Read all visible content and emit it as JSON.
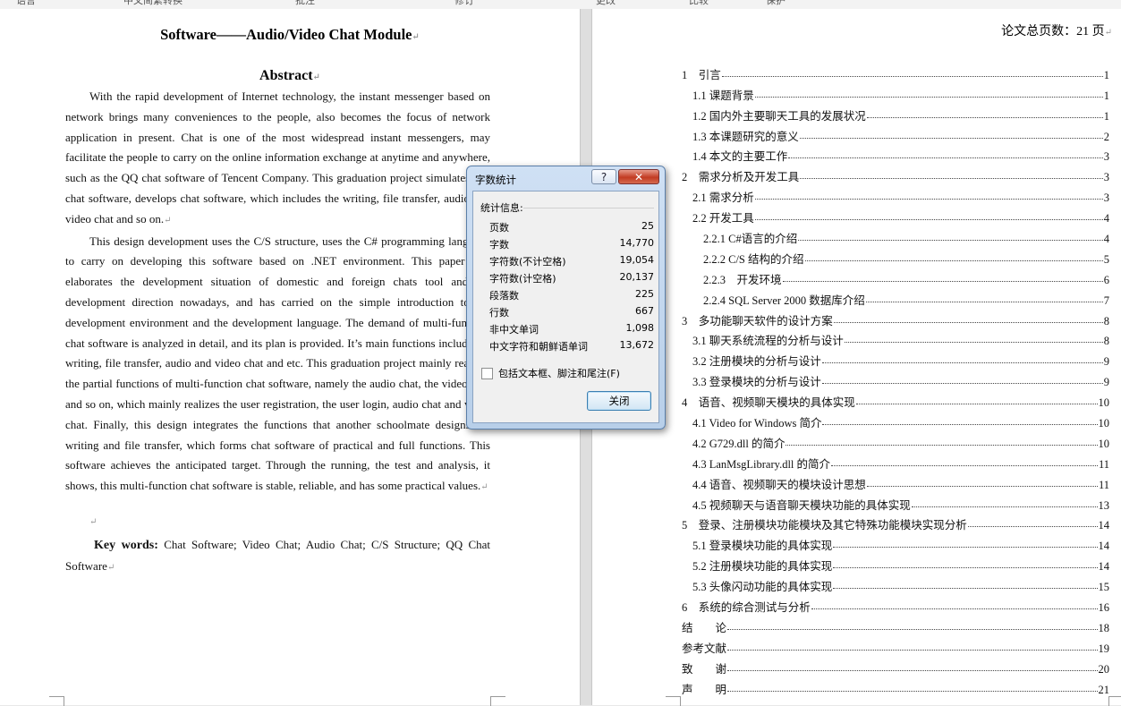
{
  "ribbon": {
    "tabs": [
      "语言",
      "中文简繁转换",
      "批注",
      "修订",
      "更改",
      "比较",
      "保护"
    ]
  },
  "left_page": {
    "title": "Software——Audio/Video Chat Module",
    "abstract_heading": "Abstract",
    "paragraph1": "With the rapid development of Internet technology, the instant messenger based on network brings many conveniences to the people, also becomes the focus of network application in present. Chat is one of the most widespread instant messengers, may facilitate the people to carry on the online information exchange at anytime and anywhere, such as the QQ chat software of Tencent Company. This graduation project simulates QQ chat software, develops chat software, which includes the writing, file transfer, audio and video chat and so on.",
    "paragraph2": "This design development uses the C/S structure, uses the C# programming language to carry on developing this software based on .NET environment. This paper first elaborates the development situation of domestic and foreign chats tool and the development direction nowadays, and has carried on the simple introduction to the development environment and the development language. The demand of multi-function chat software is analyzed in detail, and its plan is provided. It’s main functions include the writing, file transfer, audio and video chat and etc. This graduation project mainly realizes the partial functions of multi-function chat software, namely the audio chat, the video chat and so on, which mainly realizes the user registration, the user login, audio chat and video chat. Finally, this design integrates the functions that another schoolmate designs the writing and file transfer, which forms chat software of practical and full functions. This software achieves the anticipated target. Through the running, the test and analysis, it shows, this multi-function chat software is stable, reliable, and has some practical values.",
    "keywords_label": "Key words:",
    "keywords_value": "Chat Software; Video Chat; Audio Chat; C/S Structure; QQ Chat Software"
  },
  "right_page": {
    "page_count": "论文总页数：21 页",
    "toc": [
      {
        "label": "1　引言",
        "page": "1",
        "level": 0
      },
      {
        "label": "1.1 课题背景",
        "page": "1",
        "level": 1
      },
      {
        "label": "1.2 国内外主要聊天工具的发展状况",
        "page": "1",
        "level": 1
      },
      {
        "label": "1.3 本课题研究的意义",
        "page": "2",
        "level": 1
      },
      {
        "label": "1.4 本文的主要工作",
        "page": "3",
        "level": 1
      },
      {
        "label": "2　需求分析及开发工具",
        "page": "3",
        "level": 0
      },
      {
        "label": "2.1 需求分析",
        "page": "3",
        "level": 1
      },
      {
        "label": "2.2 开发工具",
        "page": "4",
        "level": 1
      },
      {
        "label": "2.2.1 C#语言的介绍",
        "page": "4",
        "level": 2
      },
      {
        "label": "2.2.2 C/S 结构的介绍",
        "page": "5",
        "level": 2
      },
      {
        "label": "2.2.3　开发环境",
        "page": "6",
        "level": 2
      },
      {
        "label": "2.2.4 SQL Server 2000 数据库介绍",
        "page": "7",
        "level": 2
      },
      {
        "label": "3　多功能聊天软件的设计方案",
        "page": "8",
        "level": 0
      },
      {
        "label": "3.1 聊天系统流程的分析与设计",
        "page": "8",
        "level": 1
      },
      {
        "label": "3.2 注册模块的分析与设计",
        "page": "9",
        "level": 1
      },
      {
        "label": "3.3 登录模块的分析与设计",
        "page": "9",
        "level": 1
      },
      {
        "label": "4　语音、视频聊天模块的具体实现",
        "page": "10",
        "level": 0
      },
      {
        "label": "4.1 Video for Windows 简介",
        "page": "10",
        "level": 1
      },
      {
        "label": "4.2 G729.dll 的简介",
        "page": "10",
        "level": 1
      },
      {
        "label": "4.3 LanMsgLibrary.dll 的简介",
        "page": "11",
        "level": 1
      },
      {
        "label": "4.4 语音、视频聊天的模块设计思想",
        "page": "11",
        "level": 1
      },
      {
        "label": "4.5 视频聊天与语音聊天模块功能的具体实现",
        "page": "13",
        "level": 1
      },
      {
        "label": "5　登录、注册模块功能模块及其它特殊功能模块实现分析",
        "page": "14",
        "level": 0
      },
      {
        "label": "5.1 登录模块功能的具体实现",
        "page": "14",
        "level": 1
      },
      {
        "label": "5.2 注册模块功能的具体实现",
        "page": "14",
        "level": 1
      },
      {
        "label": "5.3 头像闪动功能的具体实现",
        "page": "15",
        "level": 1
      },
      {
        "label": "6　系统的综合测试与分析",
        "page": "16",
        "level": 0
      },
      {
        "label": "结　　论",
        "page": "18",
        "level": 0
      },
      {
        "label": "参考文献",
        "page": "19",
        "level": 0
      },
      {
        "label": "致　　谢",
        "page": "20",
        "level": 0
      },
      {
        "label": "声　　明",
        "page": "21",
        "level": 0
      }
    ]
  },
  "dialog": {
    "title": "字数统计",
    "help": "?",
    "close_x": "✕",
    "section": "统计信息:",
    "stats": [
      {
        "label": "页数",
        "value": "25"
      },
      {
        "label": "字数",
        "value": "14,770"
      },
      {
        "label": "字符数(不计空格)",
        "value": "19,054"
      },
      {
        "label": "字符数(计空格)",
        "value": "20,137"
      },
      {
        "label": "段落数",
        "value": "225"
      },
      {
        "label": "行数",
        "value": "667"
      },
      {
        "label": "非中文单词",
        "value": "1,098"
      },
      {
        "label": "中文字符和朝鲜语单词",
        "value": "13,672"
      }
    ],
    "checkbox_label": "包括文本框、脚注和尾注(F)",
    "checkbox_checked": false,
    "close_button": "关闭"
  }
}
